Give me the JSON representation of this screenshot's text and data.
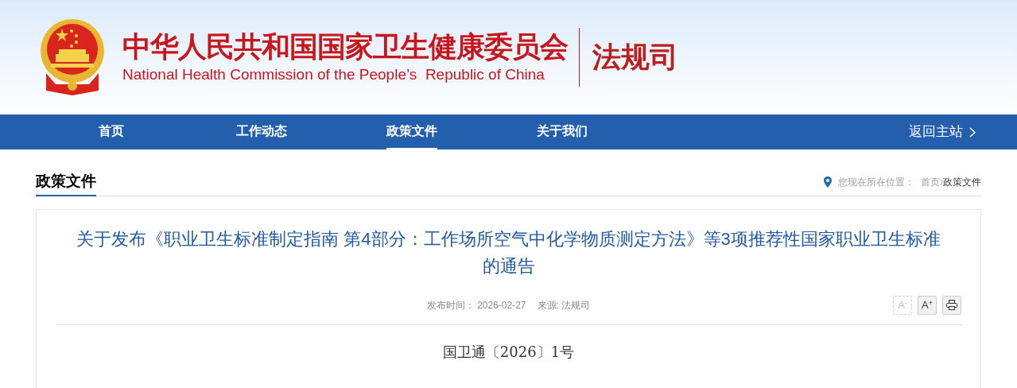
{
  "header": {
    "title": "中华人民共和国国家卫生健康委员会",
    "subtitle": "National Health Commission of the People’s  Republic of China",
    "department": "法规司"
  },
  "nav": {
    "items": [
      {
        "label": "首页",
        "selected": false
      },
      {
        "label": "工作动态",
        "selected": false
      },
      {
        "label": "政策文件",
        "selected": true
      },
      {
        "label": "关于我们",
        "selected": false
      }
    ],
    "back_link": "返回主站"
  },
  "section": {
    "title": "政策文件",
    "breadcrumb_prefix": "您现在所在位置：",
    "breadcrumb": [
      {
        "label": "首页",
        "selected": false
      },
      {
        "label": "政策文件",
        "selected": true
      }
    ]
  },
  "article": {
    "title": "关于发布《职业卫生标准制定指南 第4部分：工作场所空气中化学物质测定方法》等3项推荐性国家职业卫生标准的通告",
    "published": "发布时间： 2026-02-27",
    "source": "来源: 法规司",
    "tools": [
      {
        "kind": "font-decrease",
        "label": "A",
        "sign": "-",
        "disabled": true
      },
      {
        "kind": "font-increase",
        "label": "A",
        "sign": "+",
        "disabled": false
      },
      {
        "kind": "print",
        "disabled": false
      }
    ],
    "doc_number": "国卫通〔2026〕1号"
  }
}
